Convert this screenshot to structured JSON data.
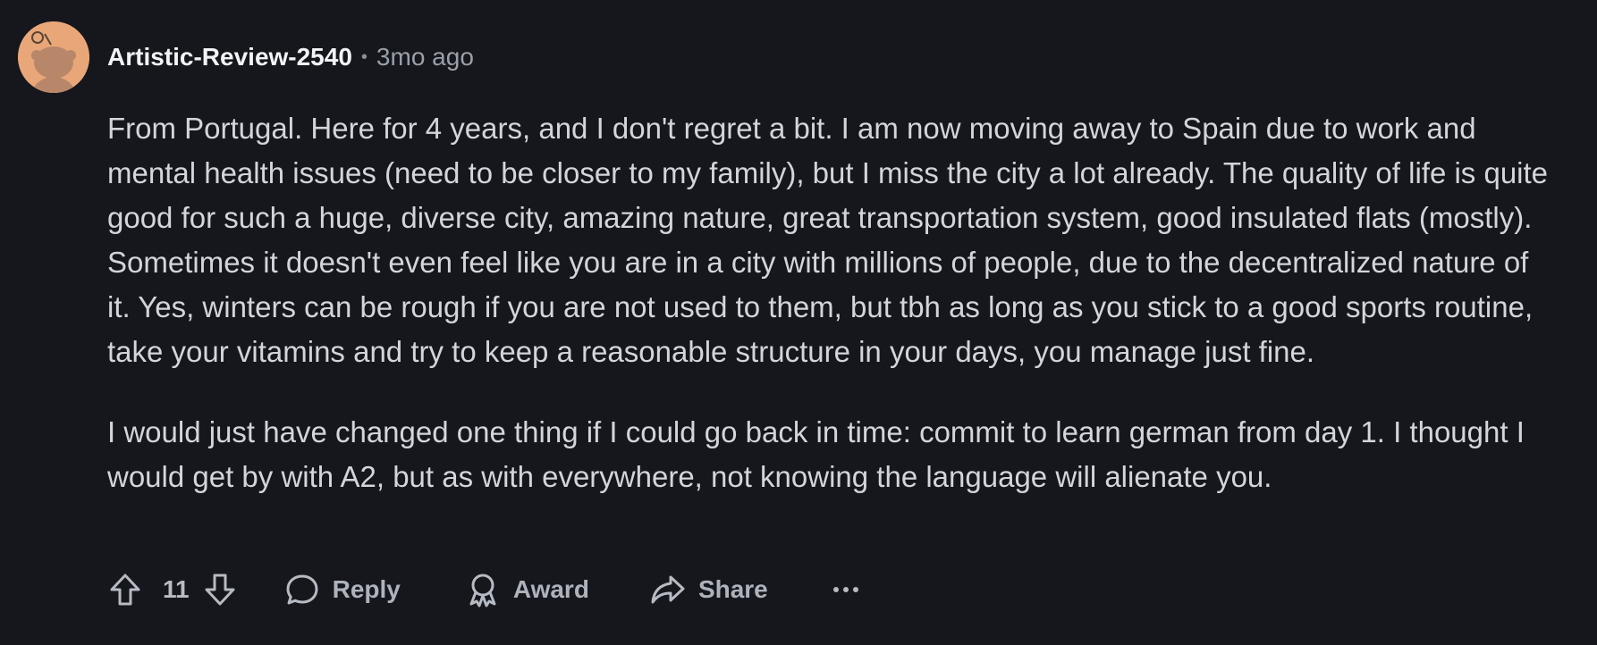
{
  "comment": {
    "author": "Artistic-Review-2540",
    "separator": "•",
    "time": "3mo ago",
    "paragraphs": [
      "From Portugal. Here for 4 years, and I don't regret a bit. I am now moving away to Spain due to work and mental health issues (need to be closer to my family), but I miss the city a lot already. The quality of life is quite good for such a huge, diverse city, amazing nature, great transportation system, good insulated flats (mostly). Sometimes it doesn't even feel like you are in a city with millions of people, due to the decentralized nature of it. Yes, winters can be rough if you are not used to them, but tbh as long as you stick to a good sports routine, take your vitamins and try to keep a reasonable structure in your days, you manage just fine.",
      "I would just have changed one thing if I could go back in time: commit to learn german from day 1. I thought I would get by with A2, but as with everywhere, not knowing the language will alienate you."
    ],
    "score": "11",
    "actions": {
      "reply": "Reply",
      "award": "Award",
      "share": "Share"
    }
  },
  "colors": {
    "background": "#16161d",
    "avatar": "#e9a779",
    "text": "#d2d5da",
    "muted": "#9aa0a8"
  },
  "icons": {
    "upvote": "upvote-arrow-icon",
    "downvote": "downvote-arrow-icon",
    "reply": "speech-bubble-icon",
    "award": "award-ribbon-icon",
    "share": "share-arrow-icon",
    "more": "ellipsis-icon"
  }
}
